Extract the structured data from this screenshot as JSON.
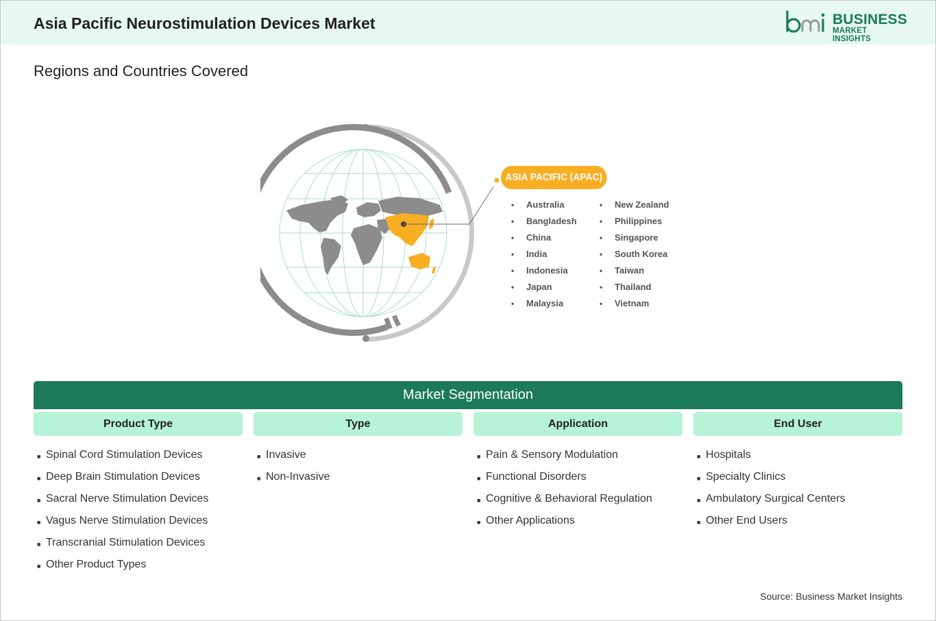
{
  "header": {
    "title": "Asia Pacific Neurostimulation Devices Market",
    "logo": {
      "mark": "bmi",
      "line1": "BUSINESS",
      "line2": "MARKET INSIGHTS"
    }
  },
  "regions": {
    "title": "Regions and Countries Covered",
    "region_label": "ASIA PACIFIC (APAC)",
    "countries_col1": [
      "Australia",
      "Bangladesh",
      "China",
      "India",
      "Indonesia",
      "Japan",
      "Malaysia"
    ],
    "countries_col2": [
      "New Zealand",
      "Philippines",
      "Singapore",
      "South Korea",
      "Taiwan",
      "Thailand",
      "Vietnam"
    ],
    "colors": {
      "highlight": "#f7ae22",
      "land": "#8c8c8c",
      "ring": "#8c8c8c",
      "grid": "#a8dcd2"
    }
  },
  "segmentation": {
    "title": "Market Segmentation",
    "columns": [
      {
        "header": "Product Type",
        "items": [
          "Spinal Cord Stimulation Devices",
          "Deep Brain Stimulation Devices",
          "Sacral Nerve Stimulation Devices",
          "Vagus Nerve Stimulation Devices",
          "Transcranial Stimulation Devices",
          "Other Product Types"
        ]
      },
      {
        "header": "Type",
        "items": [
          "Invasive",
          "Non-Invasive"
        ]
      },
      {
        "header": "Application",
        "items": [
          "Pain & Sensory Modulation",
          "Functional Disorders",
          "Cognitive & Behavioral Regulation",
          "Other Applications"
        ]
      },
      {
        "header": "End User",
        "items": [
          "Hospitals",
          "Specialty Clinics",
          "Ambulatory Surgical Centers",
          "Other End Users"
        ]
      }
    ],
    "colors": {
      "banner": "#1b7a57",
      "column_header": "#b7f3d9"
    }
  },
  "source": "Source: Business Market Insights"
}
